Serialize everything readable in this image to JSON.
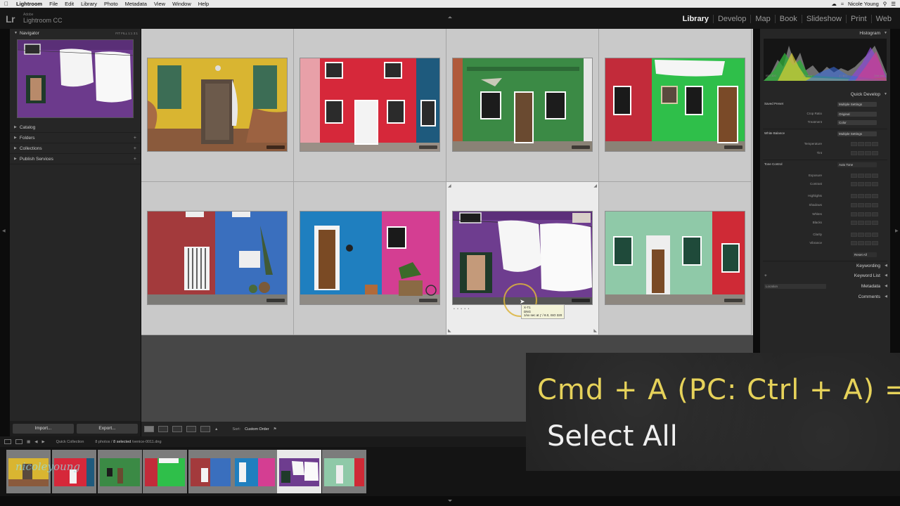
{
  "menubar": {
    "app": "Lightroom",
    "items": [
      "File",
      "Edit",
      "Library",
      "Photo",
      "Metadata",
      "View",
      "Window",
      "Help"
    ],
    "user": "Nicole Young"
  },
  "identity": {
    "logo": "Lr",
    "brand": "Adobe",
    "product": "Lightroom CC"
  },
  "modules": [
    "Library",
    "Develop",
    "Map",
    "Book",
    "Slideshow",
    "Print",
    "Web"
  ],
  "left_panel": {
    "navigator_title": "Navigator",
    "navigator_options": "FIT  FILL  1:1  3:1",
    "sections": [
      "Catalog",
      "Folders",
      "Collections",
      "Publish Services"
    ],
    "import_label": "Import...",
    "export_label": "Export..."
  },
  "grid": {
    "selected_index": 6,
    "tooltip_lines": [
      "X-T1",
      "DNG",
      "1/xx sec at ƒ / 8.0, ISO 320"
    ]
  },
  "toolbar": {
    "sort_label": "Sort:",
    "sort_value": "Custom Order"
  },
  "right_panel": {
    "histogram_title": "Histogram",
    "hist_info": [
      "ISO 320",
      "23 mm",
      "ƒ / 8.0",
      "1/xx sec"
    ],
    "quick_develop_title": "Quick Develop",
    "saved_preset_label": "Saved Preset",
    "saved_preset_value": "Multiple Settings",
    "crop_ratio_label": "Crop Ratio",
    "crop_ratio_value": "Original",
    "treatment_label": "Treatment",
    "treatment_value": "Color",
    "white_balance_label": "White Balance",
    "white_balance_value": "Multiple Settings",
    "temperature_label": "Temperature",
    "tint_label": "Tint",
    "tone_control_label": "Tone Control",
    "auto_tone_label": "Auto Tone",
    "exposure_label": "Exposure",
    "contrast_label": "Contrast",
    "highlights_label": "Highlights",
    "shadows_label": "Shadows",
    "whites_label": "Whites",
    "blacks_label": "Blacks",
    "clarity_label": "Clarity",
    "vibrance_label": "Vibrance",
    "reset_all_label": "Reset All",
    "keywording_title": "Keywording",
    "keyword_list_title": "Keyword List",
    "metadata_title": "Metadata",
    "metadata_preset": "Location",
    "comments_title": "Comments"
  },
  "filmstrip_bar": {
    "source": "Quick Collection",
    "count": "8 photos /",
    "selected": "8 selected",
    "filename": "/venice-0011.dng"
  },
  "watermark": "nicoleyoung",
  "overlay": {
    "line1": "Cmd + A (PC: Ctrl + A) =",
    "line2": "Select All"
  },
  "colors": {
    "grid_bg": "#c9c9c9",
    "selected_cell": "#ececec",
    "panel_bg": "#262626",
    "chalk_yellow": "#e6d25a",
    "active_module": "#f0f0f0"
  }
}
